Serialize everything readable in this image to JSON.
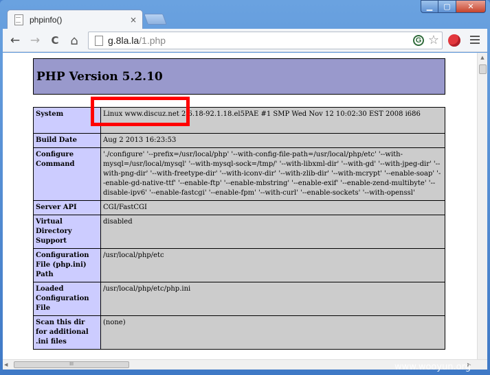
{
  "window": {
    "minimize_glyph": "▁",
    "maximize_glyph": "▢",
    "close_glyph": "✕"
  },
  "tab": {
    "title": "phpinfo()",
    "close_glyph": "×"
  },
  "toolbar": {
    "back_glyph": "←",
    "forward_glyph": "→",
    "reload_glyph": "C",
    "home_glyph": "⌂",
    "url_host": "g.8la.la",
    "url_path": "/1.php",
    "g_badge": "G",
    "star_glyph": "☆"
  },
  "page": {
    "heading": "PHP Version 5.2.10",
    "rows": [
      {
        "label": "System",
        "value": "Linux www.discuz.net 2.6.18-92.1.18.el5PAE #1 SMP Wed Nov 12 10:02:30 EST 2008 i686"
      },
      {
        "label": "Build Date",
        "value": "Aug 2 2013 16:23:53"
      },
      {
        "label": "Configure Command",
        "value": "'./configure' '--prefix=/usr/local/php' '--with-config-file-path=/usr/local/php/etc' '--with-mysql=/usr/local/mysql' '--with-mysql-sock=/tmp/' '--with-libxml-dir' '--with-gd' '--with-jpeg-dir' '--with-png-dir' '--with-freetype-dir' '--with-iconv-dir' '--with-zlib-dir' '--with-mcrypt' '--enable-soap' '--enable-gd-native-ttf' '--enable-ftp' '--enable-mbstring' '--enable-exif' '--enable-zend-multibyte' '--disable-ipv6' '--enable-fastcgi' '--enable-fpm' '--with-curl' '--enable-sockets' '--with-openssl'"
      },
      {
        "label": "Server API",
        "value": "CGI/FastCGI"
      },
      {
        "label": "Virtual Directory Support",
        "value": "disabled"
      },
      {
        "label": "Configuration File (php.ini) Path",
        "value": "/usr/local/php/etc"
      },
      {
        "label": "Loaded Configuration File",
        "value": "/usr/local/php/etc/php.ini"
      },
      {
        "label": "Scan this dir for additional .ini files",
        "value": "(none)"
      }
    ]
  },
  "scrollbar": {
    "grip": "III"
  },
  "watermark": "www.wooyun.org"
}
